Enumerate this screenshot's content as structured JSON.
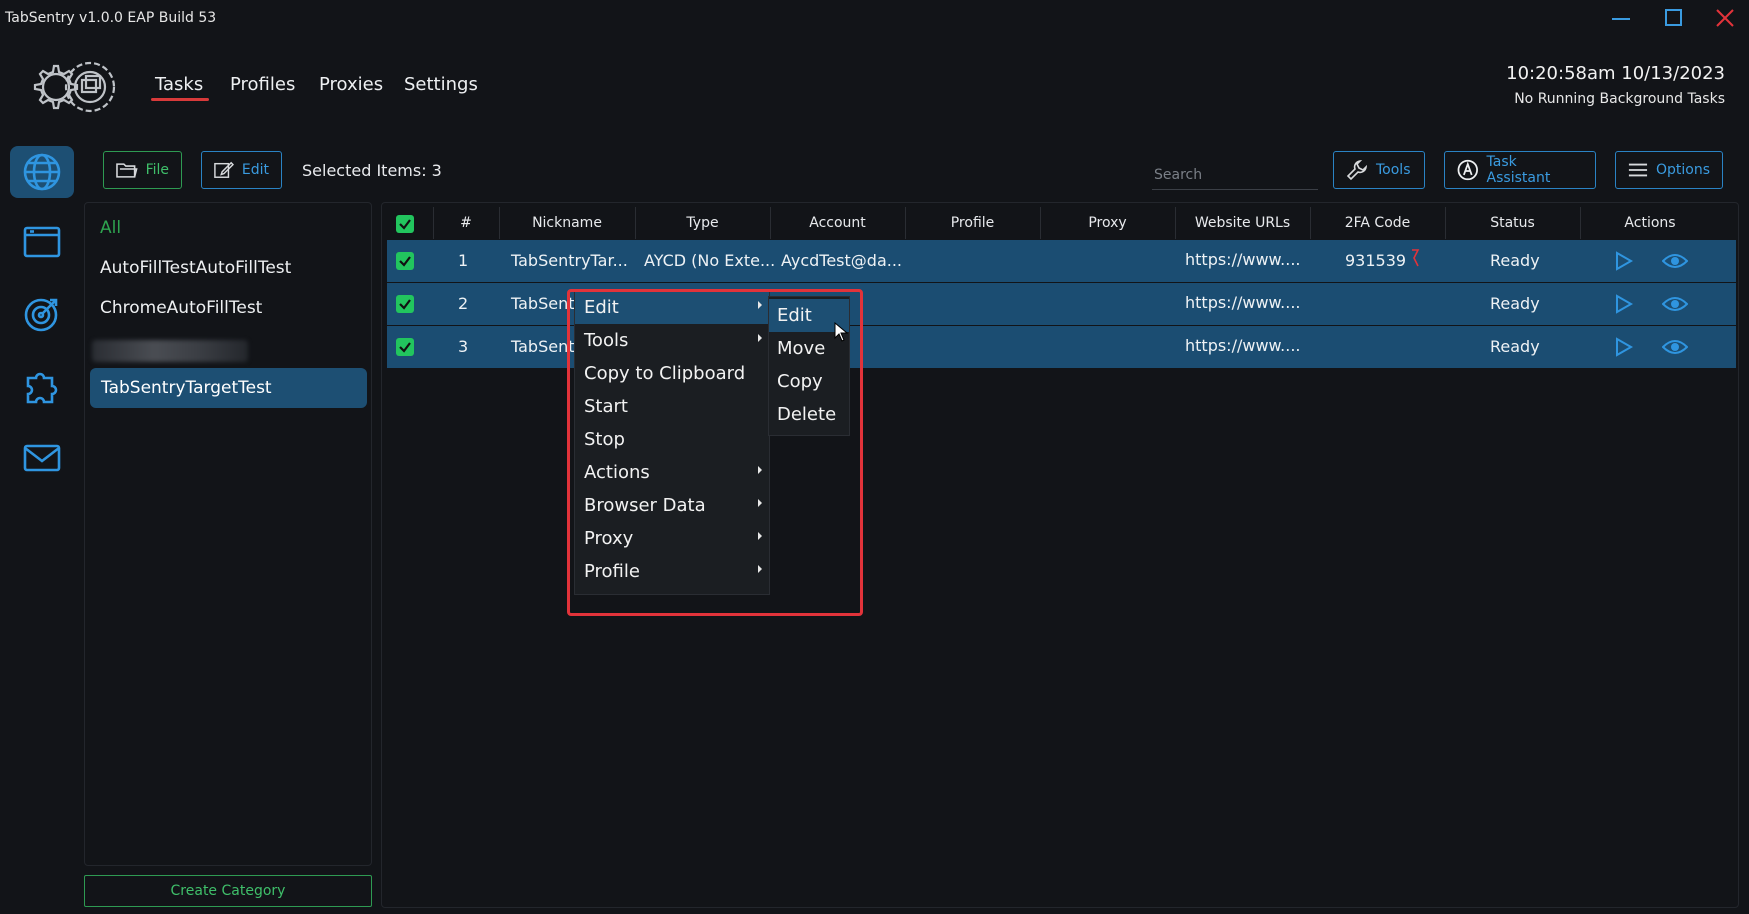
{
  "window": {
    "title": "TabSentry v1.0.0 EAP Build 53",
    "controls": [
      "minimize-icon",
      "maximize-icon",
      "close-icon"
    ]
  },
  "header": {
    "nav": [
      "Tasks",
      "Profiles",
      "Proxies",
      "Settings"
    ],
    "active_nav": "Tasks",
    "clock": "10:20:58am 10/13/2023",
    "background_status": "No Running Background Tasks"
  },
  "rail": {
    "items": [
      "globe-icon",
      "browser-window-icon",
      "target-icon",
      "puzzle-icon",
      "mail-icon"
    ],
    "active": "globe-icon"
  },
  "toolbar": {
    "file_label": "File",
    "edit_label": "Edit",
    "selected_items": "Selected Items: 3",
    "search_placeholder": "Search",
    "tools_label": "Tools",
    "assistant_label": "Task Assistant",
    "options_label": "Options"
  },
  "categories": {
    "all_label": "All",
    "items": [
      "AutoFillTestAutoFillTest",
      "ChromeAutoFillTest"
    ],
    "selected": "TabSentryTargetTest",
    "create_label": "Create Category"
  },
  "table": {
    "columns": [
      "#",
      "Nickname",
      "Type",
      "Account",
      "Profile",
      "Proxy",
      "Website URLs",
      "2FA Code",
      "Status",
      "Actions"
    ],
    "rows": [
      {
        "num": "1",
        "nickname": "TabSentryTar...",
        "type": "AYCD (No Exte...",
        "account": "AycdTest@da...",
        "profile": "",
        "proxy": "",
        "url": "https://www....",
        "code": "931539",
        "status": "Ready"
      },
      {
        "num": "2",
        "nickname": "TabSent",
        "type": "",
        "account": "",
        "profile": "",
        "proxy": "",
        "url": "https://www....",
        "code": "",
        "status": "Ready"
      },
      {
        "num": "3",
        "nickname": "TabSent",
        "type": "",
        "account": "",
        "profile": "",
        "proxy": "",
        "url": "https://www....",
        "code": "",
        "status": "Ready"
      }
    ]
  },
  "context_menu": {
    "items": [
      {
        "label": "Edit",
        "submenu": true
      },
      {
        "label": "Tools",
        "submenu": true
      },
      {
        "label": "Copy to Clipboard",
        "submenu": false
      },
      {
        "label": "Start",
        "submenu": false
      },
      {
        "label": "Stop",
        "submenu": false
      },
      {
        "label": "Actions",
        "submenu": true
      },
      {
        "label": "Browser Data",
        "submenu": true
      },
      {
        "label": "Proxy",
        "submenu": true
      },
      {
        "label": "Profile",
        "submenu": true
      }
    ],
    "highlighted": "Edit",
    "submenu": [
      "Edit",
      "Move",
      "Copy",
      "Delete"
    ],
    "submenu_highlighted": "Edit"
  },
  "colors": {
    "background": "#121418",
    "accent_blue": "#1d4f73",
    "link_blue": "#3a9be0",
    "green": "#3fbf6a",
    "nav_underline": "#d83a3a",
    "annotation_red": "#e2333a"
  }
}
